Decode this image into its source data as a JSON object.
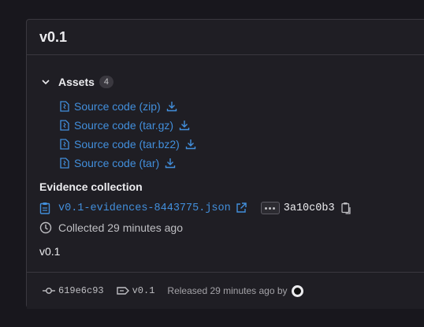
{
  "release": {
    "title": "v0.1",
    "notes": "v0.1"
  },
  "assets": {
    "label": "Assets",
    "count": "4",
    "items": [
      {
        "label": "Source code (zip)",
        "icon": "file-zip-icon"
      },
      {
        "label": "Source code (tar.gz)",
        "icon": "file-zip-icon"
      },
      {
        "label": "Source code (tar.bz2)",
        "icon": "file-zip-icon"
      },
      {
        "label": "Source code (tar)",
        "icon": "file-zip-icon"
      }
    ]
  },
  "evidence": {
    "heading": "Evidence collection",
    "file": "v0.1-evidences-8443775.json",
    "sha": "3a10c0b3",
    "collected": "Collected 29 minutes ago"
  },
  "footer": {
    "commit": "619e6c93",
    "tag": "v0.1",
    "released": "Released 29 minutes ago by"
  },
  "colors": {
    "background": "#18171d",
    "card": "#1f1e24",
    "border": "#3a383f",
    "link": "#428fdc",
    "text": "#ececef",
    "muted": "#bfbfc3"
  }
}
